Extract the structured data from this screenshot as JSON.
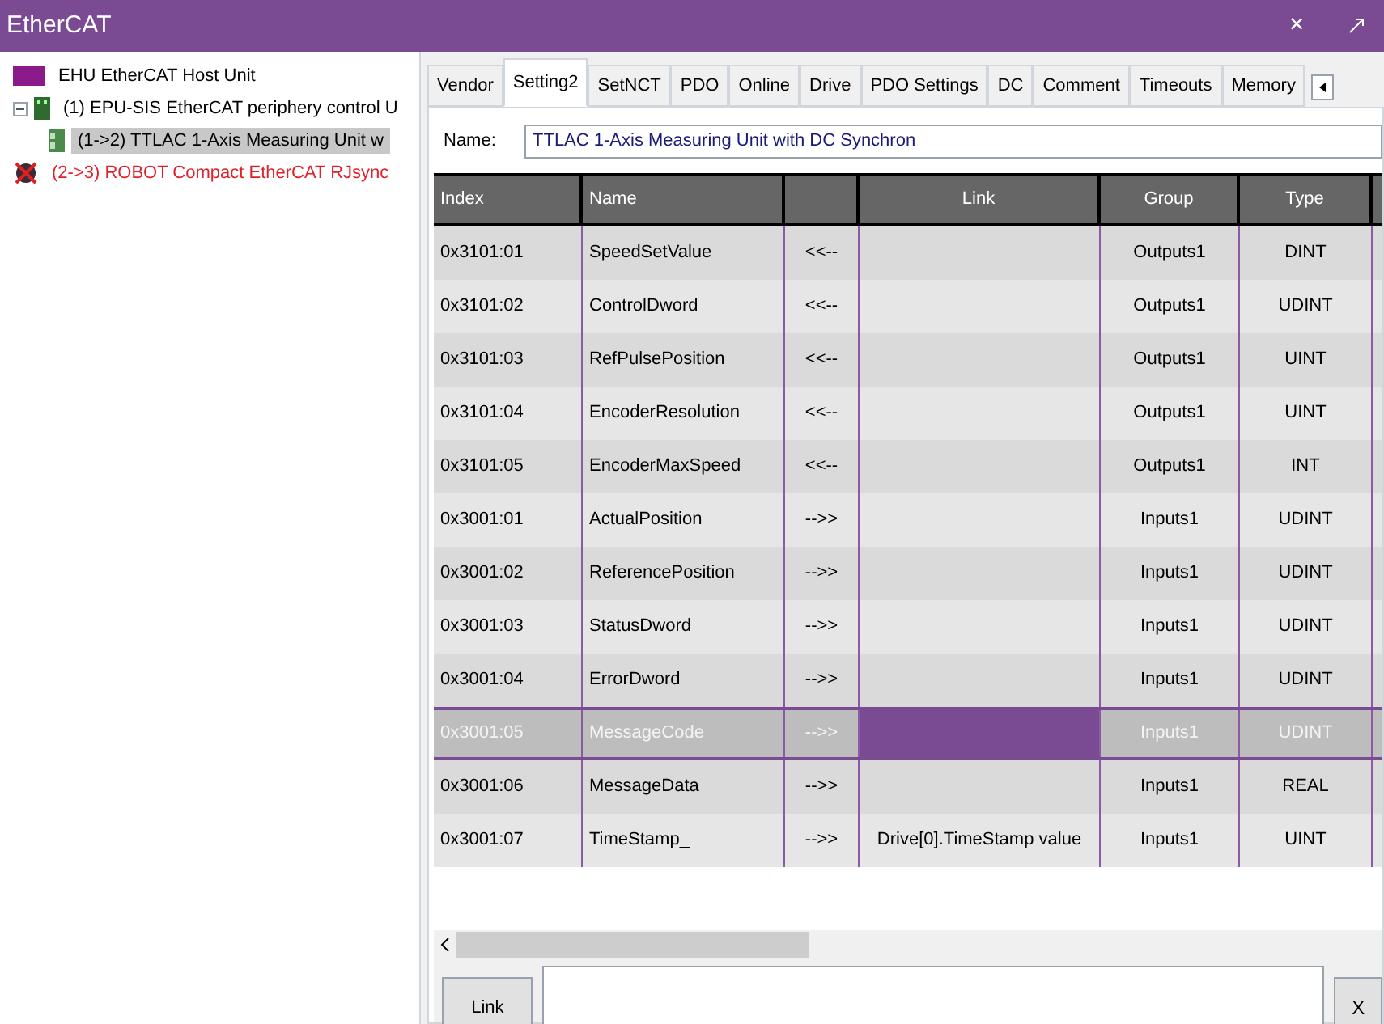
{
  "window": {
    "title": "EtherCAT",
    "close": "×"
  },
  "tree": [
    {
      "label": "EHU EtherCAT Host Unit",
      "kind": "host",
      "error": false,
      "selected": false
    },
    {
      "label": "(1) EPU-SIS EtherCAT periphery control U",
      "kind": "device",
      "error": false,
      "selected": false,
      "expanded": true,
      "children": [
        {
          "label": "(1->2) TTLAC 1-Axis Measuring Unit w",
          "kind": "module",
          "error": false,
          "selected": true
        }
      ]
    },
    {
      "label": "(2->3) ROBOT Compact EtherCAT RJsync",
      "kind": "robot",
      "error": true,
      "selected": false
    }
  ],
  "tabs": [
    {
      "label": "Vendor",
      "selected": false
    },
    {
      "label": "Setting2",
      "selected": true
    },
    {
      "label": "SetNCT",
      "selected": false
    },
    {
      "label": "PDO",
      "selected": false
    },
    {
      "label": "Online",
      "selected": false
    },
    {
      "label": "Drive",
      "selected": false
    },
    {
      "label": "PDO Settings",
      "selected": false
    },
    {
      "label": "DC",
      "selected": false
    },
    {
      "label": "Comment",
      "selected": false
    },
    {
      "label": "Timeouts",
      "selected": false
    },
    {
      "label": "Memory",
      "selected": false
    }
  ],
  "name_field": {
    "label": "Name:",
    "value": "TTLAC 1-Axis Measuring Unit with DC Synchron"
  },
  "table": {
    "columns": [
      "Index",
      "Name",
      "",
      "Link",
      "Group",
      "Type"
    ],
    "rows": [
      {
        "cells": [
          "0x3101:01",
          "SpeedSetValue",
          "<<--",
          "",
          "Outputs1",
          "DINT"
        ],
        "selected": false
      },
      {
        "cells": [
          "0x3101:02",
          "ControlDword",
          "<<--",
          "",
          "Outputs1",
          "UDINT"
        ],
        "selected": false
      },
      {
        "cells": [
          "0x3101:03",
          "RefPulsePosition",
          "<<--",
          "",
          "Outputs1",
          "UINT"
        ],
        "selected": false
      },
      {
        "cells": [
          "0x3101:04",
          "EncoderResolution",
          "<<--",
          "",
          "Outputs1",
          "UINT"
        ],
        "selected": false
      },
      {
        "cells": [
          "0x3101:05",
          "EncoderMaxSpeed",
          "<<--",
          "",
          "Outputs1",
          "INT"
        ],
        "selected": false
      },
      {
        "cells": [
          "0x3001:01",
          "ActualPosition",
          "-->>",
          "",
          "Inputs1",
          "UDINT"
        ],
        "selected": false
      },
      {
        "cells": [
          "0x3001:02",
          "ReferencePosition",
          "-->>",
          "",
          "Inputs1",
          "UDINT"
        ],
        "selected": false
      },
      {
        "cells": [
          "0x3001:03",
          "StatusDword",
          "-->>",
          "",
          "Inputs1",
          "UDINT"
        ],
        "selected": false
      },
      {
        "cells": [
          "0x3001:04",
          "ErrorDword",
          "-->>",
          "",
          "Inputs1",
          "UDINT"
        ],
        "selected": false
      },
      {
        "cells": [
          "0x3001:05",
          "MessageCode",
          "-->>",
          "",
          "Inputs1",
          "UDINT"
        ],
        "selected": true
      },
      {
        "cells": [
          "0x3001:06",
          "MessageData",
          "-->>",
          "",
          "Inputs1",
          "REAL"
        ],
        "selected": false
      },
      {
        "cells": [
          "0x3001:07",
          "TimeStamp_",
          "-->>",
          "Drive[0].TimeStamp value",
          "Inputs1",
          "UINT"
        ],
        "selected": false
      }
    ]
  },
  "bottom": {
    "link_button": "Link",
    "clear_button": "X"
  }
}
